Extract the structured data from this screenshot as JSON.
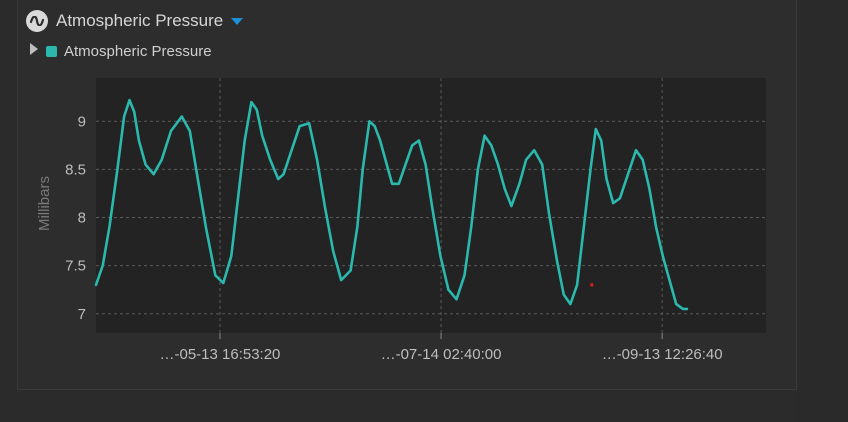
{
  "header": {
    "title": "Atmospheric Pressure",
    "icon": "wave-icon"
  },
  "legend": {
    "label": "Atmospheric Pressure",
    "expand_icon": "triangle-right-icon"
  },
  "colors": {
    "series": "#2bb8ad",
    "plot_bg": "#232323",
    "accent": "#1e90d8",
    "grid": "#5a5a5a",
    "outlier": "#e02020"
  },
  "chart_data": {
    "type": "line",
    "title": "",
    "ylabel": "Millibars",
    "xlabel": "",
    "ylim": [
      6.8,
      9.45
    ],
    "yticks": [
      7,
      7.5,
      8,
      8.5,
      9
    ],
    "xlim": [
      0,
      1
    ],
    "xticks": [
      {
        "x": 0.185,
        "label": "…-05-13 16:53:20"
      },
      {
        "x": 0.515,
        "label": "…-07-14 02:40:00"
      },
      {
        "x": 0.845,
        "label": "…-09-13 12:26:40"
      }
    ],
    "grid": true,
    "legend_position": "top-left",
    "series": [
      {
        "name": "Atmospheric Pressure",
        "points": [
          [
            0.0,
            7.3
          ],
          [
            0.01,
            7.5
          ],
          [
            0.02,
            7.9
          ],
          [
            0.032,
            8.5
          ],
          [
            0.042,
            9.05
          ],
          [
            0.05,
            9.22
          ],
          [
            0.057,
            9.1
          ],
          [
            0.064,
            8.8
          ],
          [
            0.074,
            8.55
          ],
          [
            0.086,
            8.45
          ],
          [
            0.098,
            8.6
          ],
          [
            0.112,
            8.9
          ],
          [
            0.128,
            9.05
          ],
          [
            0.14,
            8.9
          ],
          [
            0.152,
            8.4
          ],
          [
            0.164,
            7.9
          ],
          [
            0.178,
            7.4
          ],
          [
            0.19,
            7.32
          ],
          [
            0.202,
            7.6
          ],
          [
            0.212,
            8.2
          ],
          [
            0.222,
            8.8
          ],
          [
            0.232,
            9.2
          ],
          [
            0.24,
            9.12
          ],
          [
            0.248,
            8.85
          ],
          [
            0.26,
            8.6
          ],
          [
            0.272,
            8.4
          ],
          [
            0.28,
            8.45
          ],
          [
            0.292,
            8.7
          ],
          [
            0.304,
            8.95
          ],
          [
            0.318,
            8.98
          ],
          [
            0.33,
            8.6
          ],
          [
            0.342,
            8.1
          ],
          [
            0.354,
            7.65
          ],
          [
            0.366,
            7.35
          ],
          [
            0.38,
            7.45
          ],
          [
            0.39,
            7.9
          ],
          [
            0.398,
            8.5
          ],
          [
            0.408,
            9.0
          ],
          [
            0.416,
            8.95
          ],
          [
            0.424,
            8.8
          ],
          [
            0.434,
            8.55
          ],
          [
            0.442,
            8.35
          ],
          [
            0.452,
            8.35
          ],
          [
            0.462,
            8.55
          ],
          [
            0.472,
            8.75
          ],
          [
            0.482,
            8.8
          ],
          [
            0.492,
            8.55
          ],
          [
            0.502,
            8.1
          ],
          [
            0.514,
            7.6
          ],
          [
            0.526,
            7.25
          ],
          [
            0.538,
            7.15
          ],
          [
            0.55,
            7.4
          ],
          [
            0.56,
            7.9
          ],
          [
            0.57,
            8.5
          ],
          [
            0.58,
            8.85
          ],
          [
            0.59,
            8.75
          ],
          [
            0.6,
            8.55
          ],
          [
            0.61,
            8.3
          ],
          [
            0.62,
            8.12
          ],
          [
            0.632,
            8.35
          ],
          [
            0.642,
            8.6
          ],
          [
            0.654,
            8.7
          ],
          [
            0.666,
            8.55
          ],
          [
            0.676,
            8.05
          ],
          [
            0.688,
            7.55
          ],
          [
            0.698,
            7.2
          ],
          [
            0.708,
            7.1
          ],
          [
            0.718,
            7.3
          ],
          [
            0.728,
            7.9
          ],
          [
            0.738,
            8.5
          ],
          [
            0.746,
            8.92
          ],
          [
            0.754,
            8.8
          ],
          [
            0.762,
            8.4
          ],
          [
            0.772,
            8.15
          ],
          [
            0.782,
            8.2
          ],
          [
            0.794,
            8.45
          ],
          [
            0.806,
            8.7
          ],
          [
            0.816,
            8.6
          ],
          [
            0.826,
            8.3
          ],
          [
            0.836,
            7.9
          ],
          [
            0.846,
            7.6
          ],
          [
            0.856,
            7.35
          ],
          [
            0.866,
            7.1
          ],
          [
            0.876,
            7.05
          ],
          [
            0.882,
            7.05
          ]
        ]
      }
    ],
    "outliers": [
      [
        0.74,
        7.3
      ]
    ]
  }
}
